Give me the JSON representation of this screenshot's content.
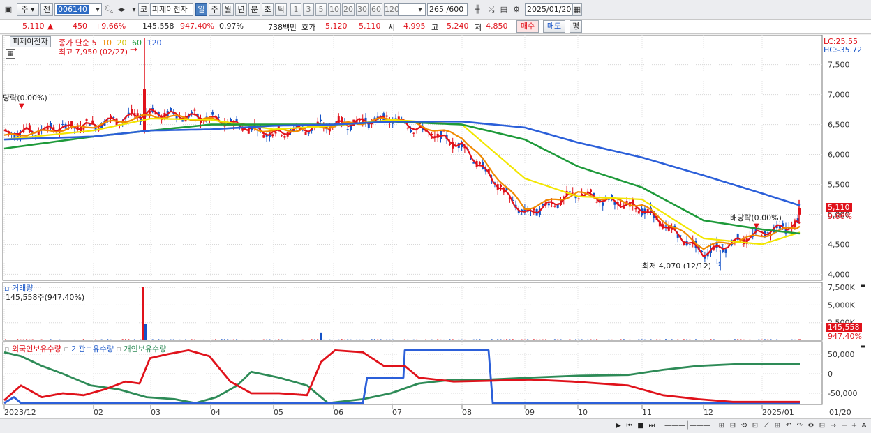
{
  "toolbar": {
    "market_select": "주",
    "prev_label": "전",
    "stock_code": "006140",
    "kospi_badge": "코",
    "stock_name": "피제이전자",
    "periods": [
      "일",
      "주",
      "월",
      "년",
      "분",
      "초",
      "틱"
    ],
    "active_period": "일",
    "intervals": [
      "1",
      "3",
      "5",
      "10",
      "20",
      "30",
      "60",
      "120"
    ],
    "count_label": "265 /600",
    "date_value": "2025/01/20"
  },
  "quote": {
    "price": "5,110",
    "change": "450",
    "change_pct": "+9.66%",
    "volume": "145,558",
    "volume_ratio": "947.40%",
    "turnover": "0.97%",
    "amount": "738백만",
    "hoga_label": "호가",
    "hoga_ask": "5,120",
    "hoga_bid": "5,110",
    "open_label": "시",
    "open": "4,995",
    "high_label": "고",
    "high": "5,240",
    "low_label": "저",
    "low": "4,850",
    "buy_btn": "매수",
    "sell_btn": "매도",
    "eval_btn": "평"
  },
  "price_panel": {
    "stock_label": "피제이전자",
    "legend_prefix": "종가 단순",
    "ma_labels": [
      "5",
      "10",
      "20",
      "60",
      "120"
    ],
    "lc_label": "LC:25.55",
    "hc_label": "HC:-35.72",
    "high_annotation": "최고 7,950 (02/27)",
    "low_annotation": "최저 4,070 (12/12)",
    "dangrak_label": "당락(0.00%)",
    "baedangrak_label": "배당락(0.00%)",
    "current_price_tag": "5,110",
    "current_pct_tag": "9.66%",
    "y_ticks": [
      "7,500",
      "7,000",
      "6,500",
      "6,000",
      "5,500",
      "5,000",
      "4,500",
      "4,000"
    ]
  },
  "volume_panel": {
    "title": "거래량",
    "subtitle": "145,558주(947.40%)",
    "y_ticks": [
      "7,500K",
      "5,000K",
      "2,500K"
    ],
    "current_tag": "145,558",
    "current_pct": "947.40%"
  },
  "holding_panel": {
    "legend": [
      "외국인보유수량",
      "기관보유수량",
      "개인보유수량"
    ],
    "y_ticks": [
      "50,000",
      "0",
      "-50,000"
    ]
  },
  "x_axis": {
    "labels": [
      "2023/12",
      "02",
      "03",
      "04",
      "05",
      "06",
      "07",
      "08",
      "09",
      "10",
      "11",
      "12",
      "2025/01",
      "01/20"
    ]
  },
  "colors": {
    "up": "#e0121b",
    "down": "#1553c7",
    "ma5": "#e0121b",
    "ma10": "#f08a00",
    "ma20": "#f2e600",
    "ma60": "#1e9a3a",
    "ma120": "#2b5fd9",
    "foreign": "#e0121b",
    "institution": "#2b5fd9",
    "individual": "#2e8b57"
  },
  "chart_data": {
    "type": "line",
    "title": "피제이전자",
    "x": [
      "2023/12",
      "02",
      "03",
      "04",
      "05",
      "06",
      "07",
      "08",
      "09",
      "10",
      "11",
      "12",
      "2025/01",
      "01/20"
    ],
    "series": [
      {
        "name": "5",
        "values": [
          6350,
          6500,
          6700,
          6600,
          6350,
          6500,
          6600,
          6150,
          5000,
          5350,
          5100,
          4350,
          4700,
          4850
        ]
      },
      {
        "name": "10",
        "values": [
          6300,
          6480,
          6650,
          6580,
          6380,
          6480,
          6600,
          6300,
          5100,
          5350,
          5150,
          4450,
          4650,
          4800
        ]
      },
      {
        "name": "20",
        "values": [
          6250,
          6400,
          6600,
          6580,
          6420,
          6480,
          6580,
          6500,
          5600,
          5300,
          5250,
          4600,
          4500,
          4700
        ]
      },
      {
        "name": "60",
        "values": [
          6100,
          6300,
          6400,
          6500,
          6500,
          6500,
          6550,
          6500,
          6250,
          5800,
          5450,
          4900,
          4750,
          4680
        ]
      },
      {
        "name": "120",
        "values": [
          6250,
          6300,
          6400,
          6420,
          6480,
          6500,
          6550,
          6550,
          6450,
          6200,
          5950,
          5650,
          5350,
          5150
        ]
      }
    ],
    "ylim": [
      3900,
      7950
    ],
    "high": {
      "value": 7950,
      "date": "02/27"
    },
    "low": {
      "value": 4070,
      "date": "12/12"
    },
    "grid": true
  }
}
